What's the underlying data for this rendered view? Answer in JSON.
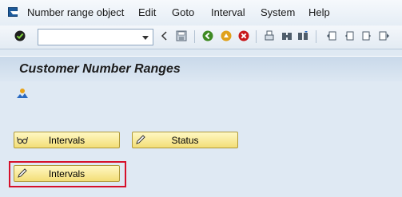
{
  "menubar": {
    "items": [
      "Number range object",
      "Edit",
      "Goto",
      "Interval",
      "System",
      "Help"
    ]
  },
  "toolbar": {
    "command_field_value": "",
    "icons": [
      "enter-icon",
      "back-icon",
      "save-icon",
      "back-green-icon",
      "exit-icon",
      "cancel-icon",
      "print-icon",
      "find-icon",
      "find-next-icon",
      "first-page-icon",
      "previous-page-icon",
      "next-page-icon",
      "last-page-icon"
    ]
  },
  "page": {
    "title": "Customer Number Ranges"
  },
  "buttons": {
    "intervals_display": "Intervals",
    "status": "Status",
    "intervals_change": "Intervals"
  },
  "colors": {
    "highlight": "#d6102a",
    "button_fill": "#f3de77",
    "background": "#dfe9f3"
  }
}
